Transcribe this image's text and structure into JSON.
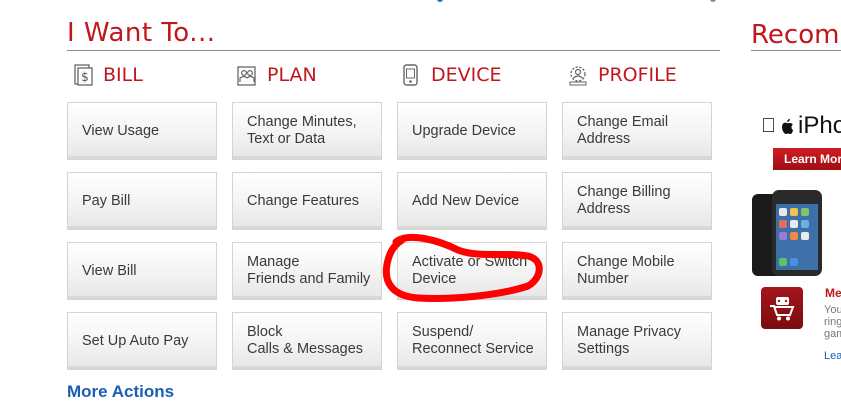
{
  "main_title": "I Want To...",
  "columns": [
    {
      "heading": "BILL",
      "icon": "dollar-document-icon",
      "items": [
        "View Usage",
        "Pay Bill",
        "View Bill",
        "Set Up Auto Pay"
      ]
    },
    {
      "heading": "PLAN",
      "icon": "plan-people-icon",
      "items": [
        "Change Minutes,\nText or Data",
        "Change Features",
        "Manage\nFriends and Family",
        "Block\nCalls & Messages"
      ]
    },
    {
      "heading": "DEVICE",
      "icon": "phone-device-icon",
      "items": [
        "Upgrade Device",
        "Add New Device",
        "Activate or Switch\nDevice",
        "Suspend/\nReconnect Service"
      ]
    },
    {
      "heading": "PROFILE",
      "icon": "gear-profile-icon",
      "items": [
        "Change Email\nAddress",
        "Change Billing\nAddress",
        "Change Mobile\nNumber",
        "Manage Privacy\nSettings"
      ]
    }
  ],
  "more_actions": "More Actions",
  "sidebar": {
    "title": "Recomm",
    "promo_name": "iPhone",
    "learn_more": "Learn Mor",
    "app_title": "Me",
    "app_desc": "You\nring\ngam",
    "app_link": "Lea"
  },
  "colors": {
    "accent_red": "#c1161c",
    "link_blue": "#1a5fb4",
    "annotation_red": "#ff0000"
  }
}
